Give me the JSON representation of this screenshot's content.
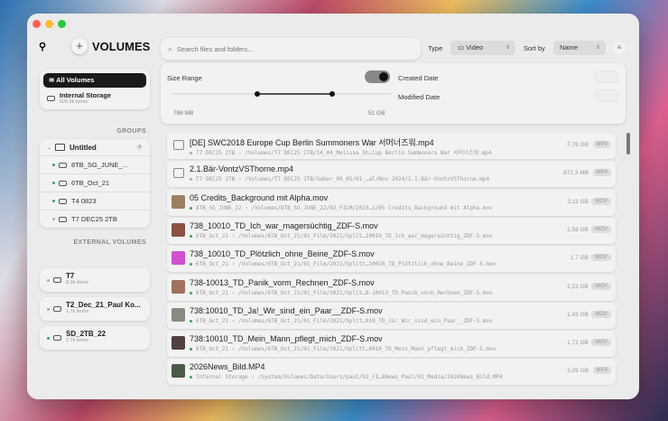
{
  "window": {
    "traffic_lights": [
      "#ff5f57",
      "#febc2e",
      "#28c840"
    ]
  },
  "sidebar": {
    "app_title": "VOLUMES",
    "all_volumes": "All Volumes",
    "internal": {
      "name": "Internal Storage",
      "count": "626.6k items"
    },
    "groups_header": "GROUPS",
    "group": {
      "name": "Untitled",
      "count": "4",
      "items": [
        {
          "name": "8TB_SG_JUNE_...",
          "status": "online"
        },
        {
          "name": "6TB_Oct_21",
          "status": "online"
        },
        {
          "name": "T4 0823",
          "status": "online"
        },
        {
          "name": "T7 DEC25 2TB",
          "status": "offline"
        }
      ]
    },
    "external_header": "EXTERNAL VOLUMES",
    "external": [
      {
        "name": "T7",
        "count": "8.3k items",
        "status": "offline"
      },
      {
        "name": "T2_Dec_21_Paul Ko...",
        "count": "1.7k items",
        "status": "offline"
      },
      {
        "name": "SD_2TB_22",
        "count": "2.7k items",
        "status": "online"
      }
    ]
  },
  "toolbar": {
    "search_placeholder": "Search files and folders...",
    "type_label": "Type",
    "type_value": "Video",
    "sort_label": "Sort by",
    "sort_value": "Name"
  },
  "filters": {
    "size_range": "Size Range",
    "size_enabled": true,
    "min": "786 MB",
    "max": "51 GB",
    "created": "Created Date",
    "created_enabled": false,
    "modified": "Modified Date",
    "modified_enabled": false
  },
  "colors": {
    "online": "#34a853",
    "offline": "#aaaaaa"
  },
  "files": [
    {
      "name": "[DE] SWC2018 Europe Cup Berlin  Summoners War  서머너즈워.mp4",
      "volume": "T7 DEC25 2TB",
      "path": "/Volumes/T7 DEC25 2TB/14_04_Melissa_Sh…Cup Berlin  Summoners War  서머너즈워.mp4",
      "size": "7,76 GB",
      "type": "MP4",
      "status": "offline",
      "thumb": "film"
    },
    {
      "name": "2.1.Bär-VontzVSThorne.mp4",
      "volume": "T7 DEC25 2TB",
      "path": "/Volumes/T7 DEC25 2TB/Saber_09_05/01_…al/Nov 2024/2.1.Bär-VontzVSThorne.mp4",
      "size": "872,3 MB",
      "type": "MP4",
      "status": "offline",
      "thumb": "film"
    },
    {
      "name": "05 Credits_Background mit Alpha.mov",
      "volume": "8TB_SG_JUNE_22",
      "path": "/Volumes/8TB_SG_JUNE_22/02_FILM/2023…s/05 Credits_Background mit Alpha.mov",
      "size": "2,11 GB",
      "type": "MOV",
      "status": "online",
      "thumb": "#9a8060"
    },
    {
      "name": "738_10010_TD_Ich_war_magersüchtig_ZDF-S.mov",
      "volume": "6TB_Oct_21",
      "path": "/Volumes/6TB_Oct_21/01_Film/2021/Split…10010_TD_Ich_war_magersüchtig_ZDF-S.mov",
      "size": "1,58 GB",
      "type": "MOV",
      "status": "online",
      "thumb": "#8a5040"
    },
    {
      "name": "738_10010_TD_Plötzlich_ohne_Beine_ZDF-S.mov",
      "volume": "6TB_Oct_21",
      "path": "/Volumes/6TB_Oct_21/01_Film/2021/Splitt…10010_TD_Plötzlich_ohne_Beine_ZDF-S.mov",
      "size": "1,7 GB",
      "type": "MOV",
      "status": "online",
      "thumb": "#d050d0"
    },
    {
      "name": "738-10013_TD_Panik_vorm_Rechnen_ZDF-S.mov",
      "volume": "6TB_Oct_21",
      "path": "/Volumes/6TB_Oct_21/01_Film/2021/Split…8-10013_TD_Panik_vorm_Rechnen_ZDF-S.mov",
      "size": "2,21 GB",
      "type": "MOV",
      "status": "online",
      "thumb": "#a07060"
    },
    {
      "name": "738:10010_TD_Ja!_Wir_sind_ein_Paar__ZDF-S.mov",
      "volume": "6TB_Oct_21",
      "path": "/Volumes/6TB_Oct_21/01_Film/2021/Split…010_TD_Ja!_Wir_sind_ein_Paar__ZDF-S.mov",
      "size": "1,43 GB",
      "type": "MOV",
      "status": "online",
      "thumb": "#8a8a80"
    },
    {
      "name": "738:10010_TD_Mein_Mann_pflegt_mich_ZDF-S.mov",
      "volume": "6TB_Oct_21",
      "path": "/Volumes/6TB_Oct_21/01_Film/2021/Splitt…0010_TD_Mein_Mann_pflegt_mich_ZDF-S.mov",
      "size": "1,71 GB",
      "type": "MOV",
      "status": "online",
      "thumb": "#504040"
    },
    {
      "name": "2026News_Bild.MP4",
      "volume": "Internal Storage",
      "path": "/System/Volumes/Data/Users/paul/02_FI…6News_Paul/01_Media/2026News_Bild.MP4",
      "size": "3,29 GB",
      "type": "MP4",
      "status": "online",
      "thumb": "#4a5a48"
    }
  ]
}
